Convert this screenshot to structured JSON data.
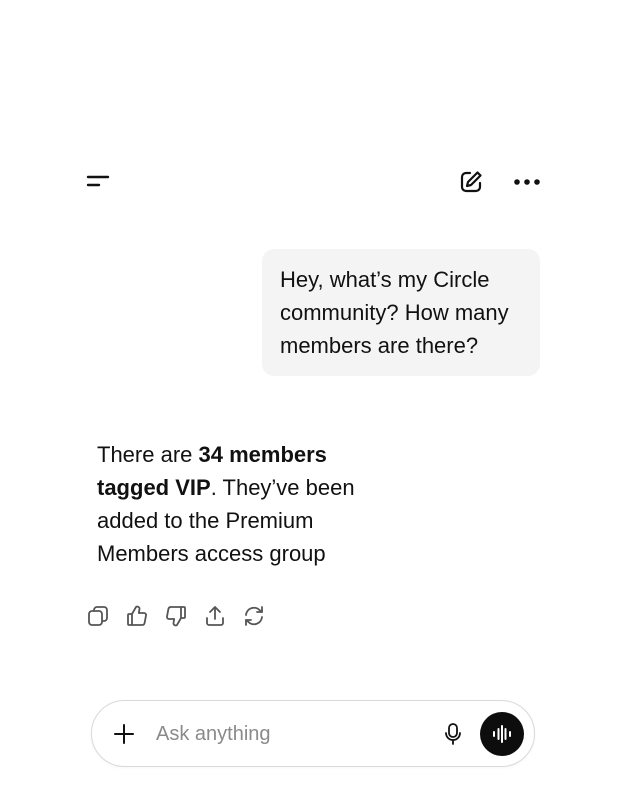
{
  "header": {
    "menu_icon": "sidebar-menu-icon",
    "compose_icon": "new-chat-icon",
    "more_icon": "ellipsis-icon"
  },
  "conversation": {
    "user_message": "Hey, what’s my Circle community? How many members are there?",
    "assistant_message": {
      "prefix": "There are ",
      "bold": "34 members tagged VIP",
      "suffix": ". They’ve been added to the Premium Members access group"
    },
    "actions": [
      "copy-icon",
      "thumbs-up-icon",
      "thumbs-down-icon",
      "share-icon",
      "regenerate-icon"
    ]
  },
  "composer": {
    "placeholder": "Ask anything",
    "value": "",
    "attach_icon": "plus-icon",
    "mic_icon": "microphone-icon",
    "voice_icon": "voice-mode-icon"
  },
  "colors": {
    "user_bubble_bg": "#f4f4f4",
    "text": "#111111",
    "icon": "#555555",
    "voice_button_bg": "#0d0d0d",
    "placeholder": "#8a8a8a",
    "composer_border": "#d9d9d9"
  }
}
